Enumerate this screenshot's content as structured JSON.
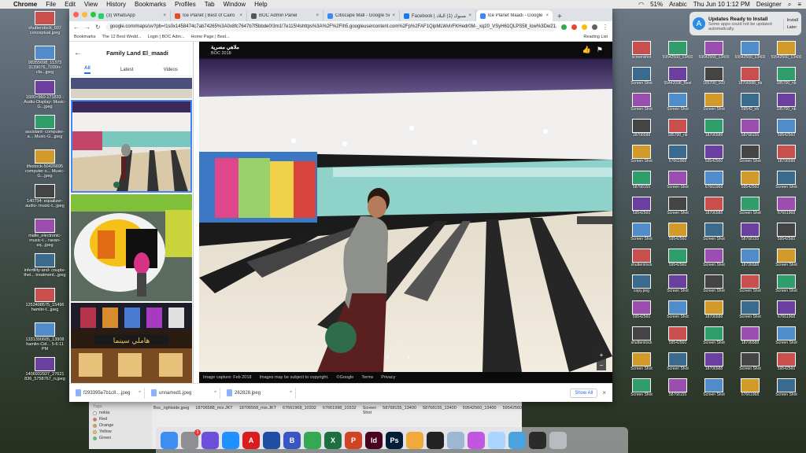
{
  "menubar": {
    "app": "Chrome",
    "items": [
      "File",
      "Edit",
      "View",
      "History",
      "Bookmarks",
      "Profiles",
      "Tab",
      "Window",
      "Help"
    ],
    "clock": "Thu Jun 10  1:12 PM",
    "user": "Designer",
    "lang": "Arabic",
    "battery": "51%"
  },
  "notification": {
    "title": "Updates Ready to Install",
    "body": "Some apps could not be updated automatically.",
    "install": "Install",
    "later": "Later"
  },
  "tabs": [
    {
      "label": "(3) WhatsApp",
      "color": "#25d366"
    },
    {
      "label": "Ice Planet | Best of Cairo",
      "color": "#e44d26"
    },
    {
      "label": "BOC Admin Panel",
      "color": "#555555"
    },
    {
      "label": "Citiscape Mall - Google Search",
      "color": "#4285f4"
    },
    {
      "label": "Facebook | فيسبوك (1) البلاد",
      "color": "#1877f2"
    },
    {
      "label": "Ice Planet Maadi - Google Se...",
      "color": "#4285f4"
    }
  ],
  "omnibox": "google.com/maps/uv?pb=!1s0x1458474c7ab74265%3A0x8fc7647b7f5bbde0!3m1!7e115!4shttps%3A%2F%2Flh5.googleusercontent.com%2Fp%2FAF1QipMLWvIrFKHedr0M-_xq20_VSyH61QLPS5lt_low%3Dw21...",
  "bookmarks": {
    "items": [
      "Bookmarks",
      "The 12 Best Wedd...",
      "Login | BOC Adm...",
      "Home Page | Best..."
    ],
    "reading_list": "Reading List"
  },
  "left_panel": {
    "title": "Family Land El_maadi",
    "tabs": [
      "All",
      "Latest",
      "Videos"
    ]
  },
  "viewer": {
    "title": "ملاهي مصرية",
    "date": "BOC 2018",
    "footer": [
      "Image capture: Feb 2018",
      "Images may be subject to copyright.",
      "©Google",
      "Terms",
      "Privacy"
    ],
    "sign_text": "هاملي سينما"
  },
  "downloads": {
    "items": [
      "f293395e7b1c8....jpeg",
      "unnamed1.jpeg",
      "262828.jpeg"
    ],
    "show_all": "Show All"
  },
  "finder": {
    "tags_header": "Tags",
    "tags": [
      {
        "label": "nokia",
        "color": "#ffffff"
      },
      {
        "label": "Red",
        "color": "#ff5b52"
      },
      {
        "label": "Orange",
        "color": "#ff9f0a"
      },
      {
        "label": "Yellow",
        "color": "#ffd60a"
      },
      {
        "label": "Green",
        "color": "#32d74b"
      }
    ],
    "files": [
      "Boc_rightside.jpeg",
      "18706588_mis.JKT",
      "18706568_mis.JKT",
      "67661968_10332",
      "67661998_10332",
      "Screen Shot",
      "58768155_13400",
      "58768155_13400",
      "59542560_13400",
      "59542560_13400"
    ]
  },
  "desktop_left": [
    "shutterstock_607 conceptual.jpeg",
    "98355698_11373 3139076_7030n-cfa...jpeg",
    "1600×960-171833 -Audio-Display- Music-G...jpeg",
    "assistant- computer-a... Music-G...jpeg",
    "lifestock-50426695 computer-s... Music-G...jpeg",
    "140734- equalizer-audio- music-t...jpeg",
    "malle_electronic- music-t... ravan-eq...jpeg",
    "infertility-and- couple-thei... treatment...jpeg",
    "1253498575_15496 hamlin-t...jpeg",
    "1331390605_13908 hamlin-Cid... 5-6:11 PM",
    "1406932927_27621 836_5758767_n.jpeg"
  ],
  "desktop_right": [
    "screenshot",
    "59542560_13400",
    "59542560_13400",
    "59542560_13400",
    "59542560_13400",
    "Screen Shot",
    "55442098_Best",
    "185700_103",
    "18706588_nb",
    "185700_nb",
    "Screen Shot",
    "Screen Shot",
    "Screen Shot",
    "59542_nb",
    "185700_nb",
    "18706588",
    "185700_nb",
    "18706588",
    "58768155",
    "59542560",
    "Screen Shot",
    "67661968",
    "59542560",
    "Screen Shot",
    "18706588",
    "58768155",
    "Screen Shot",
    "67661968",
    "59542560",
    "Screen Shot",
    "59542560",
    "Screen Shot",
    "18706588",
    "Screen Shot",
    "67661968",
    "Screen Shot",
    "59542560",
    "Screen Shot",
    "58768155",
    "59542560",
    "shutterstock",
    "59542560",
    "Screen Shot",
    "18706588",
    "Screen Shot",
    "copy.png",
    "Screen Shot",
    "Screen Shot",
    "Screen Shot",
    "Screen Shot",
    "59542560",
    "Screen Shot",
    "18706588",
    "Screen Shot",
    "67661968",
    "shutterstock",
    "59542560",
    "Screen Shot",
    "18706588",
    "Screen Shot",
    "Screen Shot",
    "Screen Shot",
    "18706588",
    "Screen Shot",
    "59542560",
    "Screen Shot",
    "58768155",
    "Screen Shot",
    "67661968",
    "Screen Shot"
  ],
  "dock": [
    {
      "name": "finder",
      "color": "#3d8ef0",
      "glyph": ""
    },
    {
      "name": "system-preferences",
      "color": "#8e8e93",
      "glyph": "",
      "badge": "1"
    },
    {
      "name": "siri",
      "color": "#6e4fd9",
      "glyph": ""
    },
    {
      "name": "safari",
      "color": "#1e90ff",
      "glyph": ""
    },
    {
      "name": "acrobat",
      "color": "#d71d1d",
      "glyph": "A"
    },
    {
      "name": "virtualbox",
      "color": "#1f4ea3",
      "glyph": ""
    },
    {
      "name": "bbedit",
      "color": "#3a56c5",
      "glyph": "B"
    },
    {
      "name": "chrome",
      "color": "#34a853",
      "glyph": ""
    },
    {
      "name": "excel",
      "color": "#1d6f42",
      "glyph": "X"
    },
    {
      "name": "powerpoint",
      "color": "#d04423",
      "glyph": "P"
    },
    {
      "name": "indesign",
      "color": "#49021f",
      "glyph": "Id"
    },
    {
      "name": "photoshop",
      "color": "#001e36",
      "glyph": "Ps"
    },
    {
      "name": "photos",
      "color": "#f2a93b",
      "glyph": ""
    },
    {
      "name": "final-cut",
      "color": "#222222",
      "glyph": ""
    },
    {
      "name": "preview",
      "color": "#9bb7d4",
      "glyph": ""
    },
    {
      "name": "color-picker",
      "color": "#c157e0",
      "glyph": ""
    },
    {
      "name": "messages",
      "color": "#aad5ff",
      "glyph": ""
    },
    {
      "name": "folder",
      "color": "#4aa3df",
      "glyph": ""
    },
    {
      "name": "terminal",
      "color": "#2b2b2b",
      "glyph": ""
    },
    {
      "name": "trash",
      "color": "#b8bcc2",
      "glyph": ""
    }
  ]
}
